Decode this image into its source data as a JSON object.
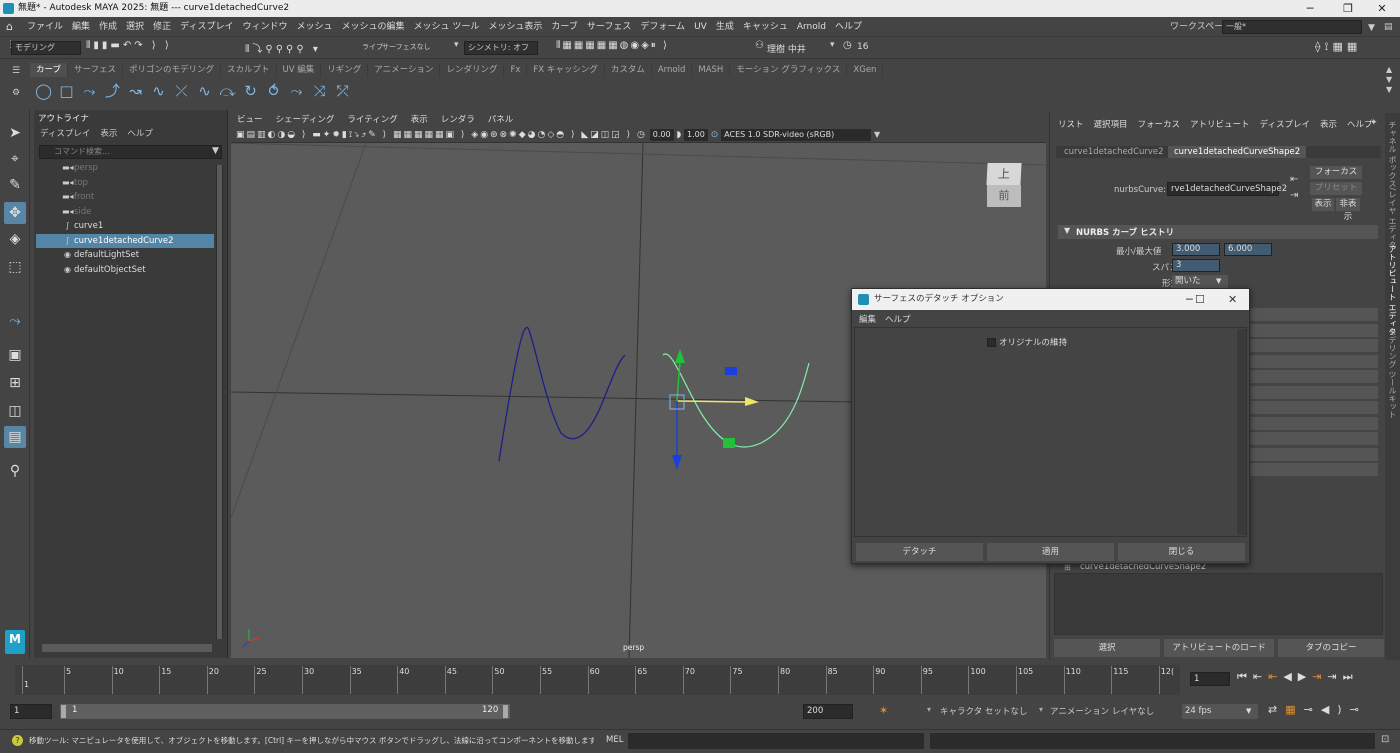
{
  "window": {
    "title": "無題* - Autodesk MAYA 2025: 無題   ---   curve1detachedCurve2",
    "min": "─",
    "max": "❐",
    "close": "✕"
  },
  "menubar": {
    "items": [
      "ファイル",
      "編集",
      "作成",
      "選択",
      "修正",
      "ディスプレイ",
      "ウィンドウ",
      "メッシュ",
      "メッシュの編集",
      "メッシュ ツール",
      "メッシュ表示",
      "カーブ",
      "サーフェス",
      "デフォーム",
      "UV",
      "生成",
      "キャッシュ",
      "Arnold",
      "ヘルプ"
    ],
    "workspace_label": "ワークスペース:",
    "workspace_value": "一般*"
  },
  "statusline": {
    "mode": "モデリング",
    "live": "ライブ",
    "surface_none": "サーフェスなし",
    "symmetry": "シンメトリ: オフ",
    "user": "理樹 中井",
    "count": "16"
  },
  "shelf": {
    "tabs": [
      "カーブ",
      "サーフェス",
      "ポリゴンのモデリング",
      "スカルプト",
      "UV 編集",
      "リギング",
      "アニメーション",
      "レンダリング",
      "Fx",
      "FX キャッシング",
      "カスタム",
      "Arnold",
      "MASH",
      "モーション グラフィックス",
      "XGen"
    ],
    "icons": [
      "◯",
      "□",
      "⤳",
      "⤴",
      "↝",
      "∿",
      "⤫",
      "∿",
      "⤼",
      "↻",
      "⥀",
      "⤳",
      "⤨",
      "⤱"
    ]
  },
  "outliner": {
    "title": "アウトライナ",
    "menus": [
      "ディスプレイ",
      "表示",
      "ヘルプ"
    ],
    "search_placeholder": "コマンド検索...",
    "rows": [
      {
        "label": "persp",
        "icon": "▬◂",
        "dim": true
      },
      {
        "label": "top",
        "icon": "▬◂",
        "dim": true
      },
      {
        "label": "front",
        "icon": "▬◂",
        "dim": true
      },
      {
        "label": "side",
        "icon": "▬◂",
        "dim": true
      },
      {
        "label": "curve1",
        "icon": "∫",
        "dim": false
      },
      {
        "label": "curve1detachedCurve2",
        "icon": "∫",
        "dim": false,
        "selected": true
      },
      {
        "label": "defaultLightSet",
        "icon": "◉",
        "dim": false
      },
      {
        "label": "defaultObjectSet",
        "icon": "◉",
        "dim": false
      }
    ]
  },
  "viewport": {
    "menus": [
      "ビュー",
      "シェーディング",
      "ライティング",
      "表示",
      "レンダラ",
      "パネル"
    ],
    "val1": "0.00",
    "val2": "1.00",
    "color_space": "ACES 1.0 SDR-video (sRGB)",
    "camera": "persp",
    "viewcube_top": "上",
    "viewcube_front": "前"
  },
  "attr_editor": {
    "menus": [
      "リスト",
      "選択項目",
      "フォーカス",
      "アトリビュート",
      "ディスプレイ",
      "表示",
      "ヘルプ"
    ],
    "tabs": [
      "curve1detachedCurve2",
      "curve1detachedCurveShape2"
    ],
    "nurbs_label": "nurbsCurve:",
    "nurbs_value": "rve1detachedCurveShape2",
    "focus_btn": "フォーカス",
    "preset_btn": "プリセット",
    "show_btn": "表示",
    "hide_btn": "非表示",
    "section": "NURBS カーブ ヒストリ",
    "minmax_label": "最小/最大値",
    "min_value": "3.000",
    "max_value": "6.000",
    "span_label": "スパン",
    "span_value": "3",
    "form_label": "形式",
    "form_value": "開いた",
    "shape_item": "curve1detachedCurveShape2",
    "footer": [
      "選択",
      "アトリビュートのロード",
      "タブのコピー"
    ],
    "side_tabs": [
      "チャネル ボックス/レイヤ エディタ",
      "アトリビュート エディタ",
      "モデリング ツールキット"
    ]
  },
  "dialog": {
    "title": "サーフェスのデタッチ オプション",
    "menus": [
      "編集",
      "ヘルプ"
    ],
    "checkbox_label": "オリジナルの維持",
    "buttons": [
      "デタッチ",
      "適用",
      "閉じる"
    ]
  },
  "timeline": {
    "ticks": [
      "1",
      "5",
      "10",
      "15",
      "20",
      "25",
      "30",
      "35",
      "40",
      "45",
      "50",
      "55",
      "60",
      "65",
      "70",
      "75",
      "80",
      "85",
      "90",
      "95",
      "100",
      "105",
      "110",
      "115",
      "12("
    ],
    "current_frame": "1"
  },
  "range": {
    "start": "1",
    "inner_start": "1",
    "inner_end": "120",
    "end": "200",
    "char_set": "キャラクタ セットなし",
    "anim_layer": "アニメーション レイヤなし",
    "fps": "24 fps"
  },
  "commandline": {
    "help": "移動ツール: マニピュレータを使用して、オブジェクトを移動します。[Ctrl] キーを押しながら中マウス ボタンでドラッグし、法線に沿ってコンポーネントを移動します。[Shift] キーを押しながらマニ",
    "mel": "MEL"
  },
  "colors": {
    "accent": "#5285a6",
    "curve1": "#1d1f8a",
    "curve2": "#7ff0a8",
    "x_axis": "#f0e36a",
    "y_axis": "#21c23a",
    "z_axis": "#1a3fe0"
  }
}
